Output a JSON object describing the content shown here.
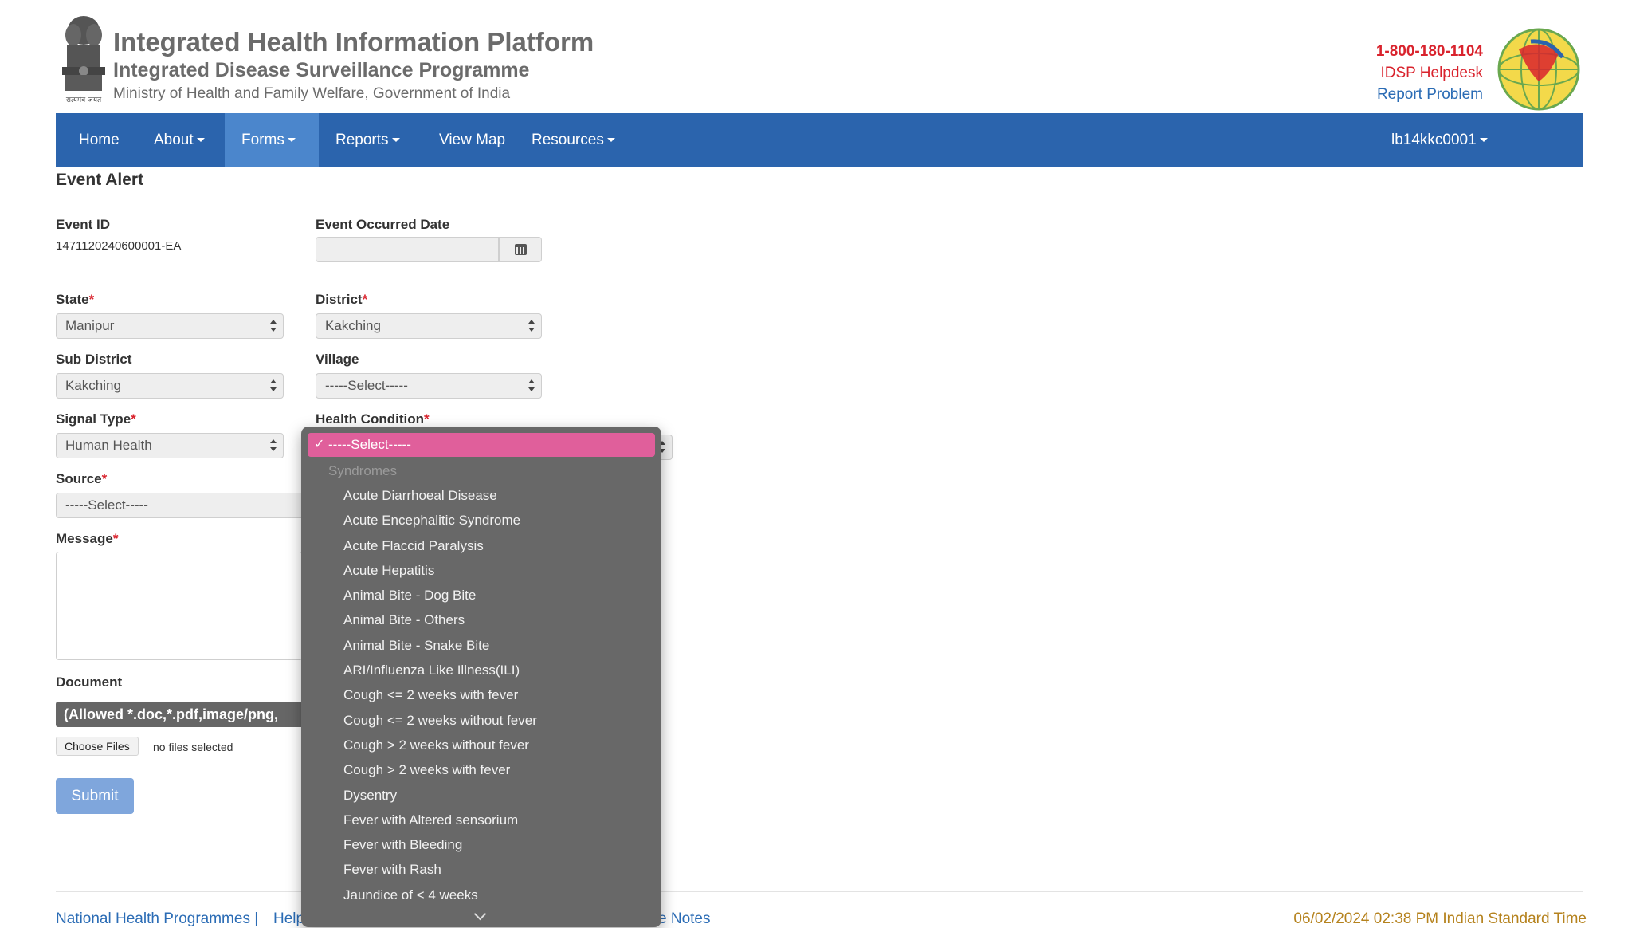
{
  "header": {
    "title": "Integrated Health Information Platform",
    "subtitle": "Integrated Disease Surveillance Programme",
    "ministry": "Ministry of Health and Family Welfare, Government of India",
    "emblem_caption": "सत्यमेव जयते",
    "helpline": "1-800-180-1104",
    "helpdesk": "IDSP Helpdesk",
    "report_problem": "Report Problem"
  },
  "nav": {
    "items": [
      {
        "label": "Home"
      },
      {
        "label": "About"
      },
      {
        "label": "Forms"
      },
      {
        "label": "Reports"
      },
      {
        "label": "View Map"
      },
      {
        "label": "Resources"
      }
    ],
    "user": "lb14kkc0001"
  },
  "form": {
    "page_title": "Event Alert",
    "event_id_label": "Event ID",
    "event_id": "1471120240600001-EA",
    "event_date_label": "Event Occurred Date",
    "event_date_value": "",
    "state_label": "State",
    "state": "Manipur",
    "district_label": "District",
    "district": "Kakching",
    "subdistrict_label": "Sub District",
    "subdistrict": "Kakching",
    "village_label": "Village",
    "village": "-----Select-----",
    "signal_type_label": "Signal Type",
    "signal_type": "Human Health",
    "health_condition_label": "Health Condition",
    "source_label": "Source",
    "source": "-----Select-----",
    "message_label": "Message",
    "document_label": "Document",
    "document_allowed": "(Allowed *.doc,*.pdf,image/png,",
    "choose_files": "Choose Files",
    "no_files": "no files selected",
    "submit": "Submit",
    "required_mark": "*"
  },
  "dropdown": {
    "selected": "-----Select-----",
    "check": "✓",
    "group": "Syndromes",
    "options": [
      "Acute Diarrhoeal Disease",
      "Acute Encephalitic Syndrome",
      "Acute Flaccid Paralysis",
      "Acute Hepatitis",
      "Animal Bite - Dog Bite",
      "Animal Bite - Others",
      "Animal Bite - Snake Bite",
      "ARI/Influenza Like Illness(ILI)",
      "Cough <= 2 weeks with fever",
      "Cough <= 2 weeks without fever",
      "Cough > 2 weeks  without fever",
      "Cough > 2 weeks with fever",
      "Dysentry",
      "Fever with Altered sensorium",
      "Fever with Bleeding",
      "Fever with Rash",
      "Jaundice of < 4 weeks"
    ]
  },
  "footer": {
    "link1": "National Health Programmes |",
    "link2": "Help",
    "link3": "e Notes",
    "datetime": "06/02/2024 02:38 PM Indian Standard Time"
  },
  "colors": {
    "navbar": "#2b64ad",
    "nav_active": "#4b86cc",
    "helpline_red": "#d9232d",
    "dropdown_highlight": "#e05f9b",
    "footer_time": "#b5821d"
  }
}
